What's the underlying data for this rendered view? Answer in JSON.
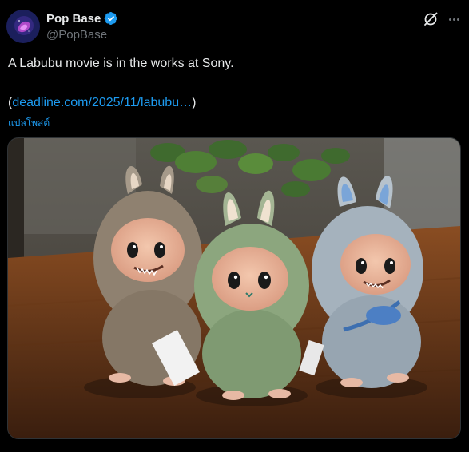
{
  "post": {
    "author": {
      "display_name": "Pop Base",
      "handle": "@PopBase",
      "verified": true
    },
    "text": "A Labubu movie is in the works at Sony.",
    "link_prefix": "(",
    "link_text": "deadline.com/2025/11/labubu…",
    "link_suffix": ")",
    "translate_label": "แปลโพสต์",
    "media_alt": "Three Labubu plush dolls in brown, green and blue on a wooden table"
  },
  "icons": {
    "verified": "verified-badge-icon",
    "grok": "grok-icon",
    "more": "more-options-icon"
  },
  "colors": {
    "background": "#000000",
    "text": "#e7e9ea",
    "secondary": "#71767b",
    "accent": "#1d9bf0",
    "border": "#2f3336"
  }
}
